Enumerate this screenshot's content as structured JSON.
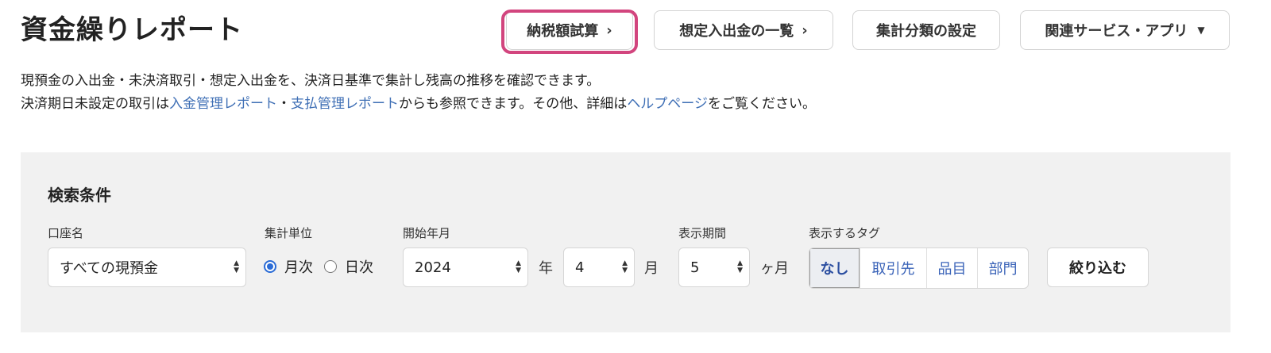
{
  "page": {
    "title": "資金繰りレポート",
    "description_line1": "現預金の入出金・未決済取引・想定入出金を、決済日基準で集計し残高の推移を確認できます。",
    "description_line2": {
      "prefix": "決済期日未設定の取引は",
      "link1": "入金管理レポート",
      "sep": "・",
      "link2": "支払管理レポート",
      "middle": "からも参照できます。その他、詳細は",
      "link3": "ヘルプページ",
      "suffix": "をご覧ください。"
    },
    "link_color": "#3f6fb5"
  },
  "top_buttons": {
    "tax_calc": "納税額試算",
    "expected_list": "想定入出金の一覧",
    "category_settings": "集計分類の設定",
    "related_services": "関連サービス・アプリ"
  },
  "highlight_color": "#d2457e",
  "search": {
    "title": "検索条件",
    "account_label": "口座名",
    "account_value": "すべての現預金",
    "unit_label": "集計単位",
    "unit_options": [
      "月次",
      "日次"
    ],
    "unit_selected": "月次",
    "start_label": "開始年月",
    "start_year": "2024",
    "year_suffix": "年",
    "start_month": "4",
    "month_suffix": "月",
    "period_label": "表示期間",
    "period_value": "5",
    "period_suffix": "ヶ月",
    "tag_label": "表示するタグ",
    "tags": [
      "なし",
      "取引先",
      "品目",
      "部門"
    ],
    "tag_selected": "なし",
    "filter_button": "絞り込む"
  }
}
